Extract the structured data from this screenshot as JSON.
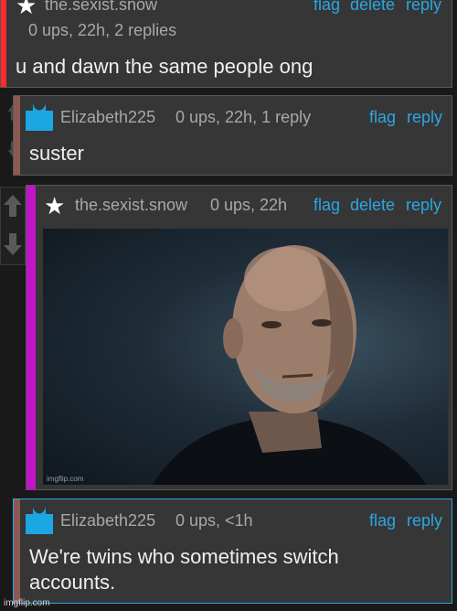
{
  "colors": {
    "page_bg": "#191919",
    "card_bg": "#363636",
    "link": "#2aa7e4",
    "bar_red": "#ff2b2b",
    "bar_brown": "#8c5a52",
    "bar_magenta": "#c213c8",
    "avatar_blue": "#1aa7e2"
  },
  "comments": [
    {
      "username": "the.sexist.snow",
      "meta": "0 ups, 22h, 2 replies",
      "text": "u and dawn the same people ong",
      "flag": "flag",
      "delete": "delete",
      "reply": "reply",
      "icon": "star-icon"
    },
    {
      "username": "Elizabeth225",
      "meta": "0 ups, 22h, 1 reply",
      "text": "suster",
      "flag": "flag",
      "reply": "reply",
      "icon": "avatar-icon"
    },
    {
      "username": "the.sexist.snow",
      "meta": "0 ups, 22h",
      "flag": "flag",
      "delete": "delete",
      "reply": "reply",
      "image_watermark": "imgflip.com",
      "icon": "star-icon"
    },
    {
      "username": "Elizabeth225",
      "meta": "0 ups, <1h",
      "text_line1": "We're twins who sometimes switch",
      "text_line2": "accounts.",
      "flag": "flag",
      "reply": "reply",
      "icon": "avatar-icon"
    }
  ],
  "footer_watermark": "imgflip.com"
}
